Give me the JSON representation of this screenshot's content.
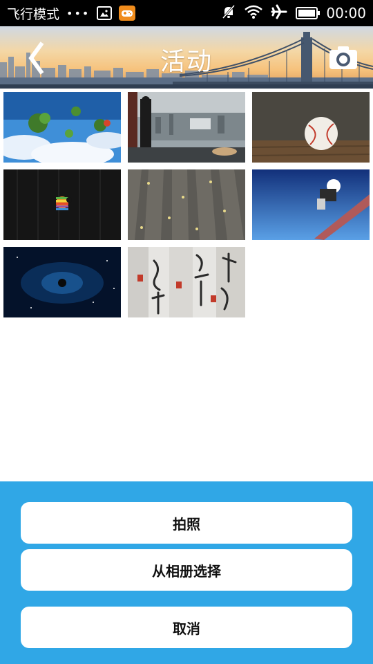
{
  "status_bar": {
    "mode_label": "飞行模式",
    "dots": "•••",
    "time": "00:00",
    "icons": [
      "image-icon",
      "game-icon",
      "mute-bell-icon",
      "wifi-icon",
      "airplane-icon",
      "battery-icon"
    ]
  },
  "header": {
    "title": "活动",
    "back_icon": "chevron-left-icon",
    "camera_icon": "camera-icon"
  },
  "gallery": {
    "images": [
      "floating-islands-sky",
      "man-overlooking-city",
      "baseball-on-wood",
      "apple-logo-dark",
      "wooden-deck-leaves",
      "snowboarder-jump",
      "apple-logo-galaxy",
      "chinese-calligraphy-scrolls"
    ]
  },
  "action_sheet": {
    "take_photo": "拍照",
    "choose_album": "从相册选择",
    "cancel": "取消"
  },
  "colors": {
    "sheet_background": "#30a7e6",
    "button_background": "#ffffff"
  }
}
